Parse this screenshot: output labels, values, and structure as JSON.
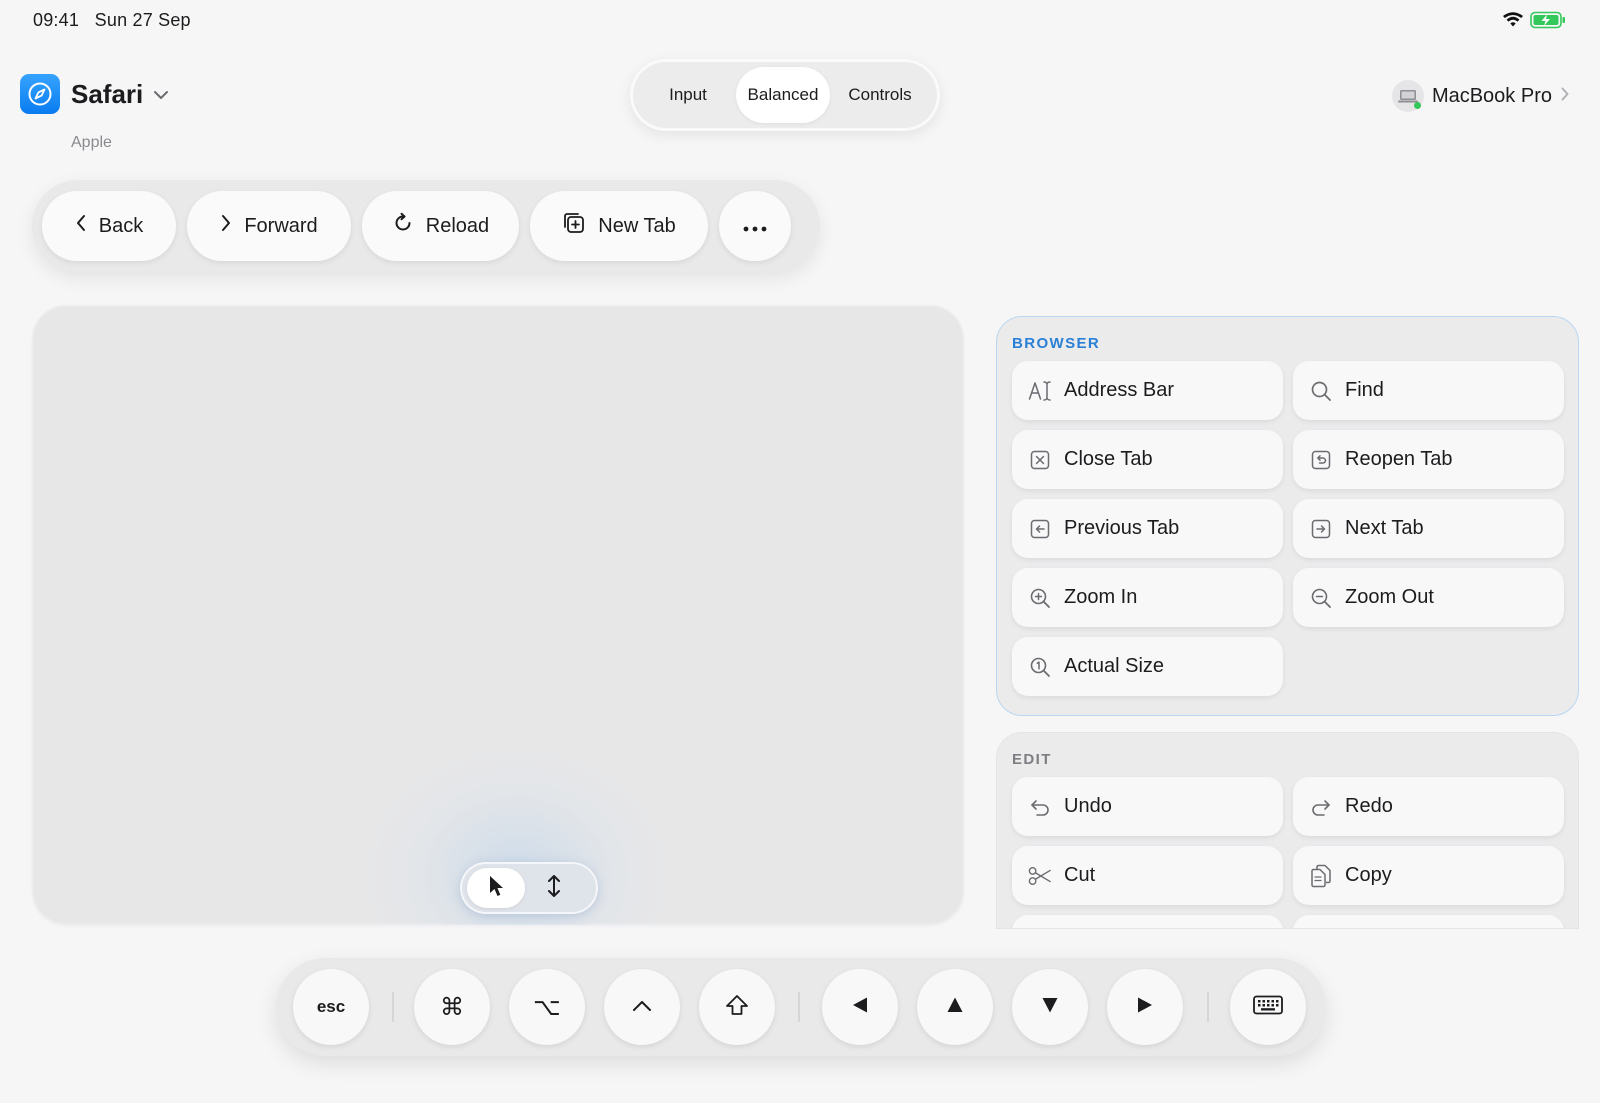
{
  "status": {
    "time": "09:41",
    "date": "Sun 27 Sep",
    "wifi_icon": "wifi-icon",
    "battery_icon": "battery-charging-icon",
    "battery_color": "#34c759"
  },
  "app": {
    "name": "Safari",
    "developer": "Apple",
    "icon": "compass-icon",
    "icon_color": "#0a84ff"
  },
  "mode_switch": {
    "options": [
      "Input",
      "Balanced",
      "Controls"
    ],
    "selected": "Balanced"
  },
  "device": {
    "name": "MacBook Pro",
    "status_color": "#34c759"
  },
  "toolbar": {
    "back": "Back",
    "forward": "Forward",
    "reload": "Reload",
    "new_tab": "New Tab",
    "more_icon": "ellipsis-icon"
  },
  "trackpad": {
    "modes": [
      "pointer",
      "scroll"
    ],
    "active_mode": "pointer"
  },
  "browser_panel": {
    "title": "BROWSER",
    "accent": "#2a7fd6",
    "actions": [
      {
        "label": "Address Bar",
        "icon": "text-cursor-icon"
      },
      {
        "label": "Find",
        "icon": "search-icon"
      },
      {
        "label": "Close Tab",
        "icon": "close-square-icon"
      },
      {
        "label": "Reopen Tab",
        "icon": "reopen-square-icon"
      },
      {
        "label": "Previous Tab",
        "icon": "arrow-left-square-icon"
      },
      {
        "label": "Next Tab",
        "icon": "arrow-right-square-icon"
      },
      {
        "label": "Zoom In",
        "icon": "zoom-in-icon"
      },
      {
        "label": "Zoom Out",
        "icon": "zoom-out-icon"
      },
      {
        "label": "Actual Size",
        "icon": "actual-size-icon"
      }
    ]
  },
  "edit_panel": {
    "title": "EDIT",
    "actions": [
      {
        "label": "Undo",
        "icon": "undo-icon"
      },
      {
        "label": "Redo",
        "icon": "redo-icon"
      },
      {
        "label": "Cut",
        "icon": "scissors-icon"
      },
      {
        "label": "Copy",
        "icon": "copy-icon"
      }
    ]
  },
  "keys": {
    "esc": "esc",
    "command": "⌘",
    "option": "⌥",
    "control": "⌃",
    "shift_icon": "shift-icon",
    "arrows": [
      "left-arrow-icon",
      "up-arrow-icon",
      "down-arrow-icon",
      "right-arrow-icon"
    ],
    "keyboard_icon": "keyboard-icon"
  }
}
